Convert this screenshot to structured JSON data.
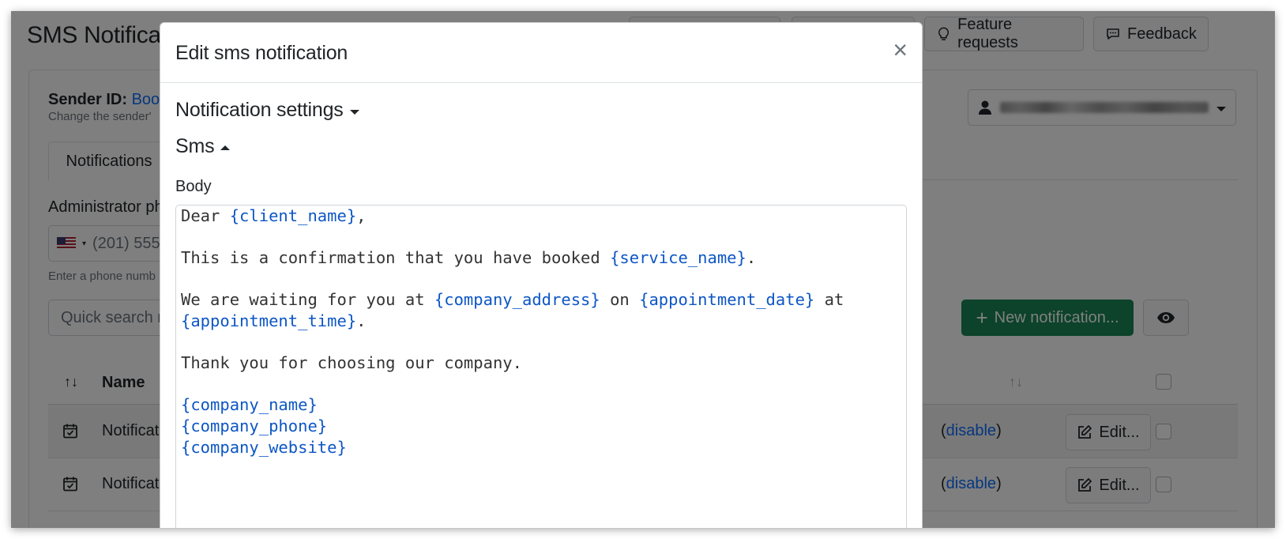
{
  "page": {
    "title": "SMS Notifica",
    "top_buttons": [
      {
        "label": "",
        "icon": "blank"
      },
      {
        "label": "",
        "icon": "blank"
      },
      {
        "label": "Feature requests",
        "icon": "lightbulb-icon"
      },
      {
        "label": "Feedback",
        "icon": "chat-icon"
      }
    ],
    "sender": {
      "label": "Sender ID:",
      "value": "Book",
      "help": "Change the sender'"
    },
    "tab_active": "Notifications",
    "admin_phone_label": "Administrator ph",
    "phone_placeholder": "(201) 555",
    "phone_help": "Enter a phone numb",
    "search_placeholder": "Quick search n",
    "new_notification_label": "New notification...",
    "table": {
      "name_header": "Name",
      "rows": [
        {
          "name": "Notificat",
          "status_link": "disable",
          "edit_label": "Edit..."
        },
        {
          "name": "Notificat",
          "status_link": "disable",
          "edit_label": "Edit..."
        }
      ]
    }
  },
  "modal": {
    "title": "Edit sms notification",
    "close_glyph": "×",
    "notification_settings_label": "Notification settings",
    "sms_label": "Sms",
    "body_label": "Body",
    "body_lines": [
      [
        {
          "t": "Dear "
        },
        {
          "v": "{client_name}"
        },
        {
          "t": ","
        }
      ],
      [],
      [
        {
          "t": "This is a confirmation that you have booked "
        },
        {
          "v": "{service_name}"
        },
        {
          "t": "."
        }
      ],
      [],
      [
        {
          "t": "We are waiting for you at "
        },
        {
          "v": "{company_address}"
        },
        {
          "t": " on "
        },
        {
          "v": "{appointment_date}"
        },
        {
          "t": " at"
        }
      ],
      [
        {
          "v": "{appointment_time}"
        },
        {
          "t": "."
        }
      ],
      [],
      [
        {
          "t": "Thank you for choosing our company."
        }
      ],
      [],
      [
        {
          "v": "{company_name}"
        }
      ],
      [
        {
          "v": "{company_phone}"
        }
      ],
      [
        {
          "v": "{company_website}"
        }
      ]
    ]
  },
  "colors": {
    "accent": "#0d6efd",
    "variable": "#0d56c5",
    "success": "#198754"
  }
}
